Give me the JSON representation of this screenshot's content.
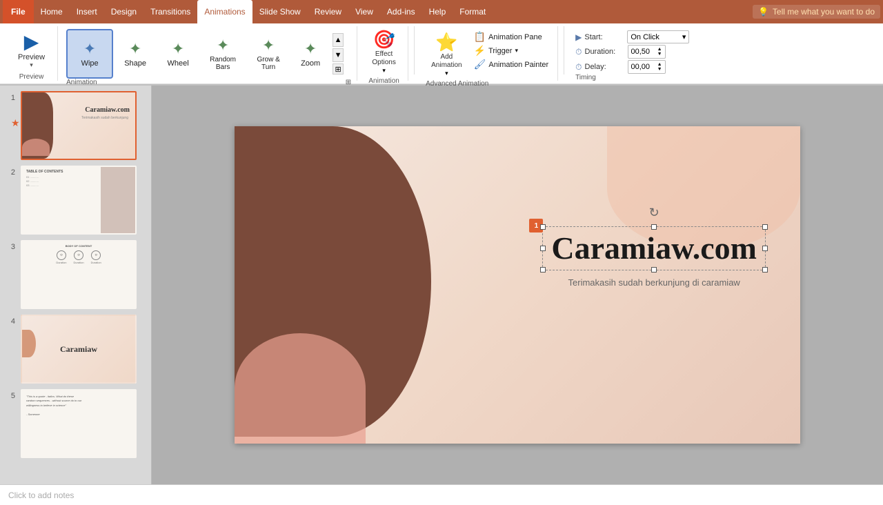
{
  "menubar": {
    "file_label": "File",
    "items": [
      "Home",
      "Insert",
      "Design",
      "Transitions",
      "Animations",
      "Slide Show",
      "Review",
      "View",
      "Add-ins",
      "Help",
      "Format"
    ],
    "active": "Animations",
    "search_placeholder": "Tell me what you want to do",
    "search_icon": "💡"
  },
  "toolbar": {
    "preview": {
      "label": "Preview",
      "icon": "▶",
      "arrow": "▾"
    },
    "animations": {
      "items": [
        {
          "name": "Wipe",
          "icon": "✦",
          "selected": true
        },
        {
          "name": "Shape",
          "icon": "✦"
        },
        {
          "name": "Wheel",
          "icon": "✦"
        },
        {
          "name": "Random Bars",
          "icon": "✦"
        },
        {
          "name": "Grow & Turn",
          "icon": "✦"
        },
        {
          "name": "Zoom",
          "icon": "✦"
        }
      ]
    },
    "effect_options": {
      "label": "Effect\nOptions",
      "icon": "🎯"
    },
    "add_animation": {
      "label": "Add\nAnimation",
      "icon": "⭐"
    },
    "animation_pane": {
      "label": "Animation Pane",
      "icon": "📋"
    },
    "trigger": {
      "label": "Trigger",
      "icon": "⚡"
    },
    "animation_painter": {
      "label": "Animation Painter",
      "icon": "🖌"
    },
    "timing": {
      "start_label": "Start:",
      "start_value": "On Click",
      "duration_label": "Duration:",
      "duration_value": "00,50",
      "delay_label": "Delay:",
      "delay_value": "00,00"
    },
    "group_labels": {
      "preview": "Preview",
      "animation": "Animation",
      "advanced": "Advanced Animation",
      "timing": "Timing"
    }
  },
  "slides": [
    {
      "num": 1,
      "type": "title",
      "active": true,
      "has_star": true,
      "has_anim": true
    },
    {
      "num": 2,
      "type": "text",
      "active": false,
      "has_star": false
    },
    {
      "num": 3,
      "type": "icons",
      "active": false,
      "has_star": false
    },
    {
      "num": 4,
      "type": "logo",
      "active": false,
      "has_star": false
    },
    {
      "num": 5,
      "type": "text2",
      "active": false,
      "has_star": false
    }
  ],
  "slide_content": {
    "title": "Caramiaw.com",
    "subtitle": "Terimakasih sudah berkunjung di caramiaw",
    "anim_badge": "1"
  },
  "notes": {
    "placeholder": "Click to add notes"
  }
}
